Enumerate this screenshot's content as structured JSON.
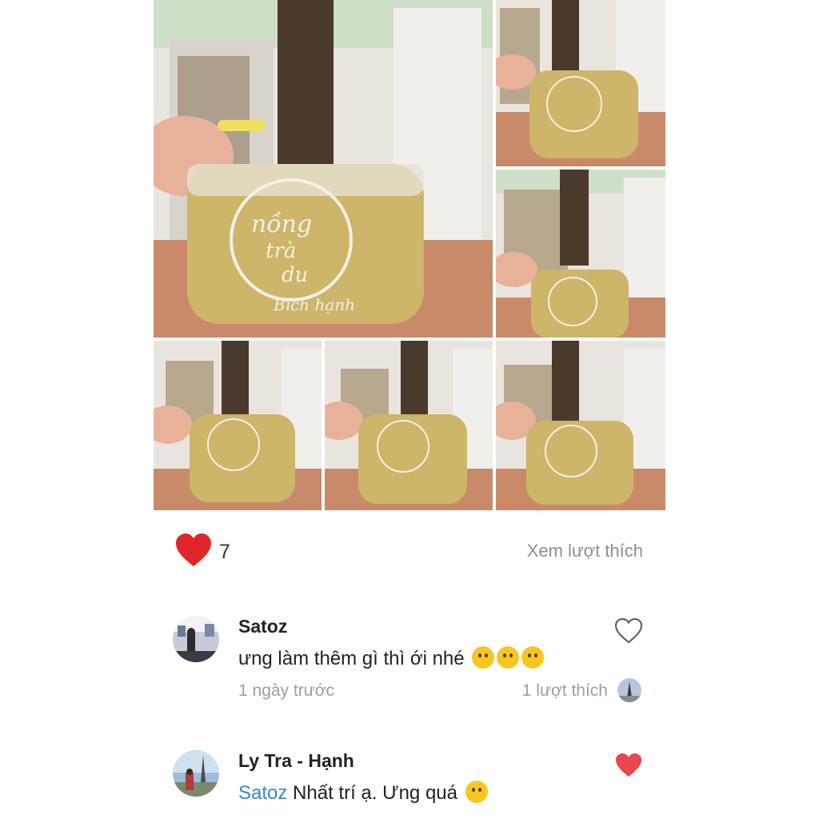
{
  "gallery": {
    "photos": [
      {
        "name": "photo-nong-tra-du"
      },
      {
        "name": "photo-da-biet"
      },
      {
        "name": "photo-happiness"
      },
      {
        "name": "photo-an-tru"
      },
      {
        "name": "photo-breathe-and-smile"
      },
      {
        "name": "photo-the-way-out"
      }
    ]
  },
  "likes": {
    "count": "7",
    "see_likes_label": "Xem lượt thích",
    "heart_color": "#e0262b"
  },
  "comments": [
    {
      "author": "Satoz",
      "text": "ưng làm thêm gì thì ới nhé",
      "emojis": [
        "zany-face-emoji",
        "smiling-face-with-hearts-emoji",
        "smiling-face-with-hearts-emoji"
      ],
      "time": "1 ngày trước",
      "like_count": "1 lượt thích",
      "liked": false
    },
    {
      "author": "Ly Tra - Hạnh",
      "mention": "Satoz",
      "text": "Nhất trí ạ. Ưng quá",
      "emojis": [
        "grinning-face-emoji"
      ],
      "liked": true
    }
  ],
  "colors": {
    "mention": "#3a86c8",
    "muted": "#9aa0a6",
    "liked_heart": "#e8474b"
  }
}
